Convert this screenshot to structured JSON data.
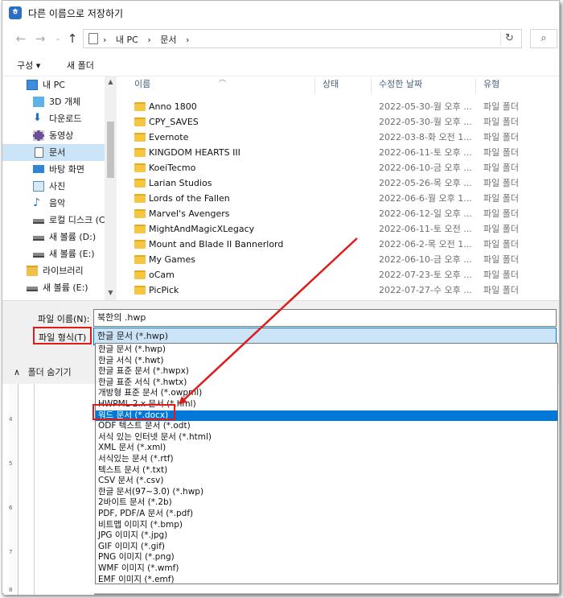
{
  "window": {
    "title": "다른 이름으로 저장하기",
    "app_icon": "hwp-icon"
  },
  "address": {
    "crumbs": [
      "내 PC",
      "문서"
    ],
    "separators": [
      "›",
      "›",
      "›"
    ]
  },
  "toolbar": {
    "organize_label": "구성 ▾",
    "new_folder_label": "새 폴더"
  },
  "nav": {
    "items": [
      {
        "label": "내 PC",
        "icon": "pc-icon"
      },
      {
        "label": "3D 개체",
        "icon": "3d-objects-icon"
      },
      {
        "label": "다운로드",
        "icon": "download-icon"
      },
      {
        "label": "동영상",
        "icon": "video-icon"
      },
      {
        "label": "문서",
        "icon": "document-icon"
      },
      {
        "label": "바탕 화면",
        "icon": "desktop-icon"
      },
      {
        "label": "사진",
        "icon": "picture-icon"
      },
      {
        "label": "음악",
        "icon": "music-icon"
      },
      {
        "label": "로컬 디스크 (C",
        "icon": "drive-icon"
      },
      {
        "label": "새 볼륨 (D:)",
        "icon": "drive-icon"
      },
      {
        "label": "새 볼륨 (E:)",
        "icon": "drive-icon"
      },
      {
        "label": "라이브러리",
        "icon": "library-icon"
      },
      {
        "label": "새 볼륨 (E:)",
        "icon": "drive-icon"
      }
    ]
  },
  "columns": {
    "name": "이름",
    "status": "상태",
    "modified": "수정한 날짜",
    "type": "유형"
  },
  "files": [
    {
      "name": "Anno 1800",
      "date": "2022-05-30-월 오후 ...",
      "type": "파일 폴더"
    },
    {
      "name": "CPY_SAVES",
      "date": "2022-05-30-월 오후 ...",
      "type": "파일 폴더"
    },
    {
      "name": "Evernote",
      "date": "2022-03-8-화 오전 1...",
      "type": "파일 폴더"
    },
    {
      "name": "KINGDOM HEARTS III",
      "date": "2022-06-11-토 오후 ...",
      "type": "파일 폴더"
    },
    {
      "name": "KoeiTecmo",
      "date": "2022-06-10-금 오후 ...",
      "type": "파일 폴더"
    },
    {
      "name": "Larian Studios",
      "date": "2022-05-26-목 오후 ...",
      "type": "파일 폴더"
    },
    {
      "name": "Lords of the Fallen",
      "date": "2022-06-6-월 오후 1...",
      "type": "파일 폴더"
    },
    {
      "name": "Marvel's Avengers",
      "date": "2022-06-12-일 오후 ...",
      "type": "파일 폴더"
    },
    {
      "name": "MightAndMagicXLegacy",
      "date": "2022-06-11-토 오전 ...",
      "type": "파일 폴더"
    },
    {
      "name": "Mount and Blade II Bannerlord",
      "date": "2022-06-2-목 오전 1...",
      "type": "파일 폴더"
    },
    {
      "name": "My Games",
      "date": "2022-06-10-금 오후 ...",
      "type": "파일 폴더"
    },
    {
      "name": "oCam",
      "date": "2022-07-23-토 오후 ...",
      "type": "파일 폴더"
    },
    {
      "name": "PicPick",
      "date": "2022-07-27-수 오후 ...",
      "type": "파일 폴더"
    }
  ],
  "form": {
    "filename_label": "파일 이름(N):",
    "filename_value": "북한의 .hwp",
    "filetype_label": "파일 형식(T)",
    "filetype_value": "한글 문서 (*.hwp)",
    "hide_folders_label": "폴더 숨기기"
  },
  "filetype_options": [
    "한글 문서 (*.hwp)",
    "한글 서식 (*.hwt)",
    "한글 표준 문서 (*.hwpx)",
    "한글 표준 서식 (*.hwtx)",
    "개방형 표준 문서 (*.owpml)",
    "HWPML 2.x 문서 (*.hml)",
    "워드 문서 (*.docx)",
    "ODF 텍스트 문서 (*.odt)",
    "서식 있는 인터넷 문서 (*.html)",
    "XML 문서 (*.xml)",
    "서식있는 문서 (*.rtf)",
    "텍스트 문서 (*.txt)",
    "CSV 문서 (*.csv)",
    "한글 문서(97~3.0) (*.hwp)",
    "2바이트 문서 (*.2b)",
    "PDF, PDF/A 문서 (*.pdf)",
    "비트맵 이미지 (*.bmp)",
    "JPG 이미지 (*.jpg)",
    "GIF 이미지 (*.gif)",
    "PNG 이미지 (*.png)",
    "WMF 이미지 (*.wmf)",
    "EMF 이미지 (*.emf)"
  ],
  "selected_option": "워드 문서 (*.docx)",
  "ruler_marks": [
    "4",
    "5",
    "6",
    "7",
    "8"
  ],
  "colors": {
    "accent": "#0078d7",
    "annotation_red": "#e01b1b",
    "folder": "#f5c642"
  }
}
